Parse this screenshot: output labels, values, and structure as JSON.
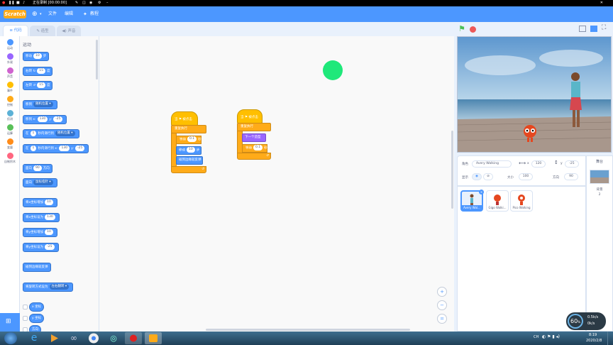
{
  "recording_bar": {
    "title": "正在录制 [00:00:00]"
  },
  "menu": {
    "logo": "Scratch",
    "file": "文件",
    "edit": "编辑",
    "tutorials": "教程"
  },
  "tabs": [
    {
      "label": "代码"
    },
    {
      "label": "造型"
    },
    {
      "label": "声音"
    }
  ],
  "categories": [
    {
      "label": "运动",
      "color": "#4c97ff"
    },
    {
      "label": "外观",
      "color": "#9966ff"
    },
    {
      "label": "声音",
      "color": "#cf63cf"
    },
    {
      "label": "事件",
      "color": "#ffbf00"
    },
    {
      "label": "控制",
      "color": "#ffab19"
    },
    {
      "label": "侦测",
      "color": "#5cb1d6"
    },
    {
      "label": "运算",
      "color": "#59c059"
    },
    {
      "label": "变量",
      "color": "#ff8c1a"
    },
    {
      "label": "自制积木",
      "color": "#ff6680"
    }
  ],
  "palette": {
    "heading": "运动",
    "move": {
      "pre": "移动",
      "val": "10",
      "post": "步"
    },
    "turn_right": {
      "pre": "右转",
      "val": "15",
      "post": "度"
    },
    "turn_left": {
      "pre": "左转",
      "val": "15",
      "post": "度"
    },
    "goto": {
      "pre": "移到",
      "dd": "随机位置"
    },
    "goto_xy": {
      "x_label": "移到 x:",
      "x": "130",
      "y_label": "y:",
      "y": "-25"
    },
    "glide": {
      "pre": "在",
      "sec": "1",
      "mid": "秒内滑行到",
      "dd": "随机位置"
    },
    "glide_xy": {
      "pre": "在",
      "sec": "1",
      "mid": "秒内滑行到 x:",
      "x": "130",
      "y_label": "y:",
      "y": "-25"
    },
    "point_dir": {
      "pre": "面向",
      "val": "90",
      "post": "方向"
    },
    "point_to": {
      "pre": "面向",
      "dd": "鼠标指针"
    },
    "change_x": {
      "pre": "将x坐标增加",
      "val": "10"
    },
    "set_x": {
      "pre": "将x坐标设为",
      "val": "130"
    },
    "change_y": {
      "pre": "将y坐标增加",
      "val": "10"
    },
    "set_y": {
      "pre": "将y坐标设为",
      "val": "-25"
    },
    "bounce": "碰到边缘就反弹",
    "rotation": {
      "pre": "将旋转方式设为",
      "dd": "左右翻转"
    },
    "rep_x": "x 坐标",
    "rep_y": "y 坐标",
    "rep_dir": "方向"
  },
  "script1": {
    "hat": "当 ⚑ 被点击",
    "forever": "重复执行",
    "wait_pre": "等待",
    "wait_val": "0.1",
    "wait_post": "秒",
    "move_pre": "移动",
    "move_val": "10",
    "move_post": "步",
    "bounce": "碰到边缘就反弹"
  },
  "script2": {
    "hat": "当 ⚑ 被点击",
    "forever": "重复执行",
    "next": "下一个造型",
    "wait_pre": "等待",
    "wait_val": "0.1",
    "wait_post": "秒"
  },
  "zoom": {
    "in": "+",
    "out": "−",
    "reset": "="
  },
  "sprite_info": {
    "sprite_label": "角色",
    "sprite_name": "Avery Walking",
    "x_label": "x",
    "x": "120",
    "y_label": "y",
    "y": "-25",
    "show_label": "显示",
    "size_label": "大小",
    "size": "100",
    "dir_label": "方向",
    "dir": "90"
  },
  "sprites": [
    {
      "name": "Avery Wal..."
    },
    {
      "name": "Gigo Walki..."
    },
    {
      "name": "Pico Walking"
    }
  ],
  "stage_panel": {
    "title": "舞台",
    "backdrop_label": "背景",
    "backdrop_count": "2"
  },
  "taskbar": {
    "time": "8:19",
    "date": "2020/2/8",
    "lang": "CH"
  },
  "fps": {
    "value": "60",
    "unit": "%",
    "up": "0.5k/s",
    "down": "0k/s"
  }
}
